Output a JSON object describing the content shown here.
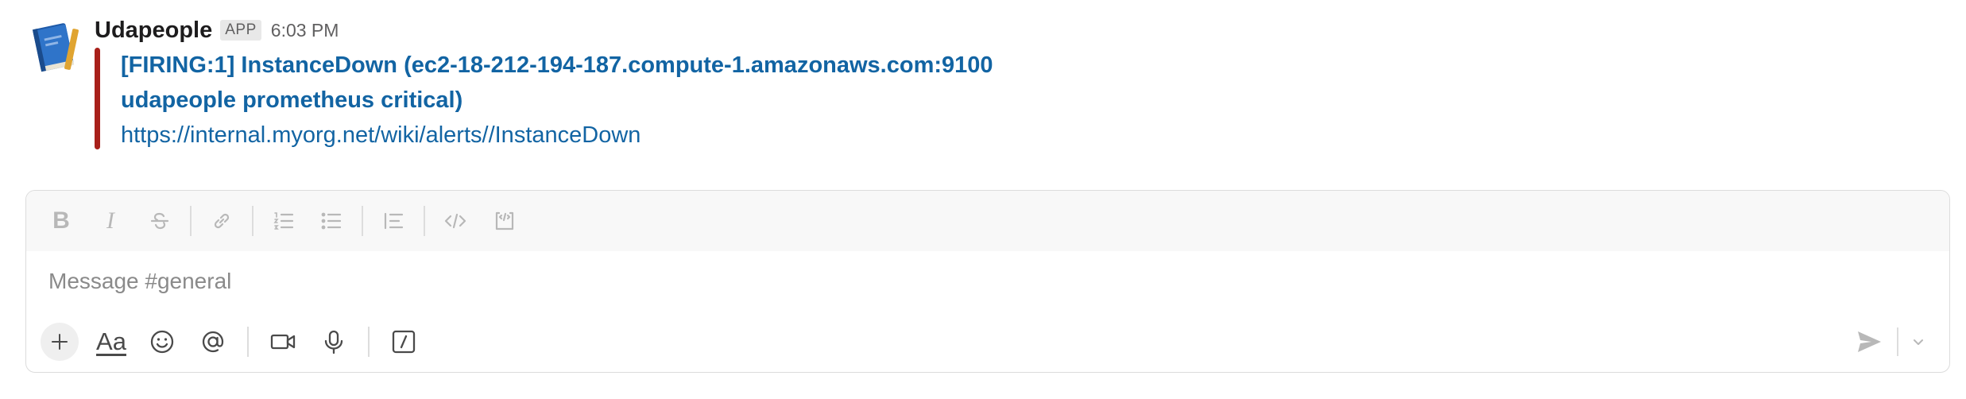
{
  "message": {
    "sender": "Udapeople",
    "badge": "APP",
    "time": "6:03 PM",
    "avatar_icon": "blue-book-icon",
    "attachment": {
      "color": "#a8201a",
      "title_lines": [
        "[FIRING:1] InstanceDown (ec2-18-212-194-187.compute-1.amazonaws.com:9100",
        "udapeople prometheus critical)"
      ],
      "link": "https://internal.myorg.net/wiki/alerts//InstanceDown"
    }
  },
  "composer": {
    "placeholder": "Message #general",
    "value": "",
    "format_toolbar": [
      {
        "name": "bold-button",
        "icon": "bold-icon",
        "label": "B"
      },
      {
        "name": "italic-button",
        "icon": "italic-icon",
        "label": "I"
      },
      {
        "name": "strikethrough-button",
        "icon": "strikethrough-icon"
      },
      {
        "name": "link-button",
        "icon": "link-icon"
      },
      {
        "name": "ordered-list-button",
        "icon": "ordered-list-icon"
      },
      {
        "name": "bulleted-list-button",
        "icon": "bulleted-list-icon"
      },
      {
        "name": "blockquote-button",
        "icon": "blockquote-icon"
      },
      {
        "name": "code-button",
        "icon": "code-icon"
      },
      {
        "name": "code-block-button",
        "icon": "code-block-icon"
      }
    ],
    "bottom_toolbar": {
      "format_text_label": "Aa",
      "icons": [
        "plus-icon",
        "format-text-icon",
        "emoji-icon",
        "mention-icon",
        "video-icon",
        "microphone-icon",
        "slash-command-icon"
      ],
      "send_icon": "send-icon",
      "send_options_icon": "chevron-down-icon"
    }
  }
}
